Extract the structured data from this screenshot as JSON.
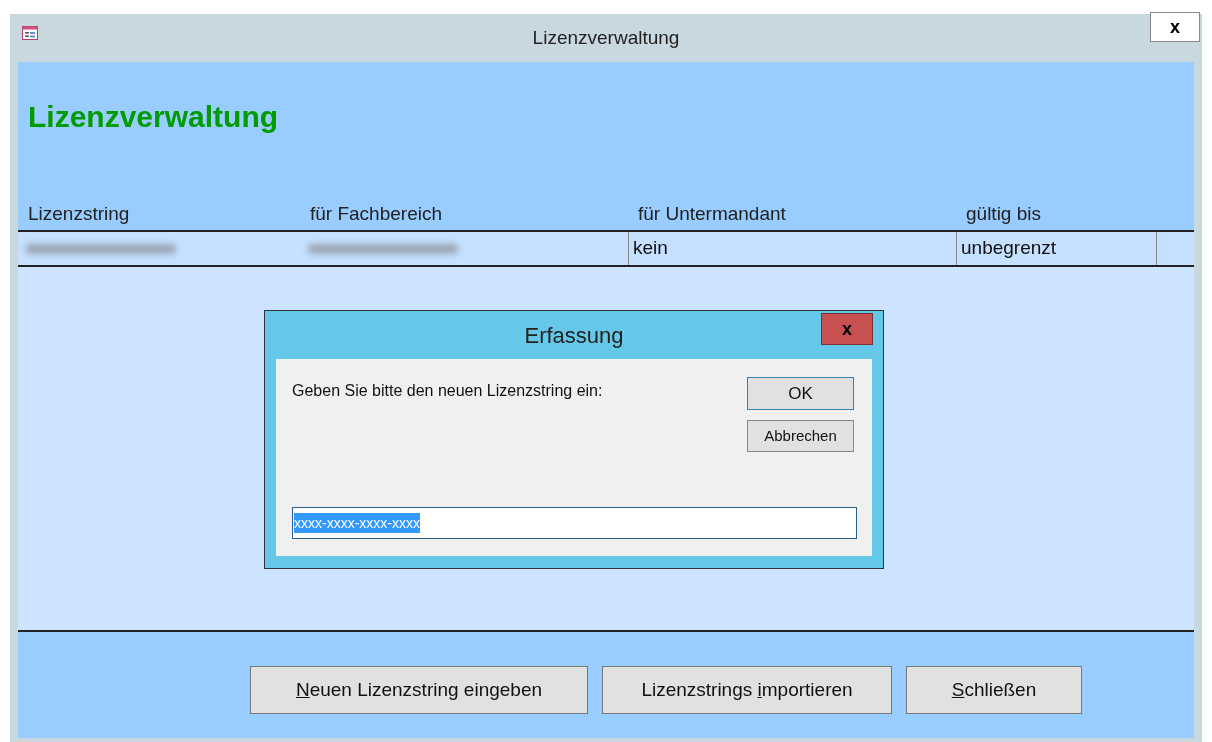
{
  "window": {
    "title": "Lizenzverwaltung",
    "close": "x"
  },
  "form": {
    "heading": "Lizenzverwaltung",
    "table": {
      "columns": [
        "Lizenzstring",
        "für Fachbereich",
        "für Untermandant",
        "gültig bis"
      ],
      "rows": [
        {
          "cells": [
            {
              "kind": "redacted"
            },
            {
              "kind": "redacted"
            },
            {
              "kind": "text",
              "text": "kein"
            },
            {
              "kind": "text",
              "text": "unbegrenzt"
            }
          ]
        }
      ]
    },
    "buttons": [
      {
        "key": "N",
        "after": "euen Lizenzstring eingeben"
      },
      {
        "before": "Lizenzstrings ",
        "key": "i",
        "after": "mportieren"
      },
      {
        "key": "S",
        "after": "chließen"
      }
    ]
  },
  "dialog": {
    "title": "Erfassung",
    "close": "x",
    "prompt": "Geben Sie bitte den neuen Lizenzstring ein:",
    "buttons": [
      "OK",
      "Abbrechen"
    ],
    "input": {
      "value": "xxxx-xxxx-xxxx-xxxx",
      "selected": true
    }
  }
}
